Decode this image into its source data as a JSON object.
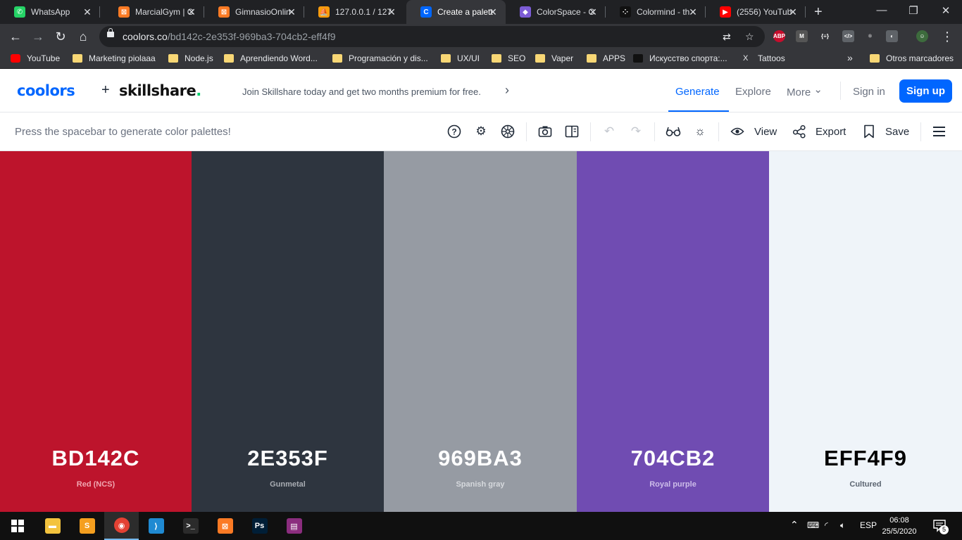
{
  "browser": {
    "tabs": [
      {
        "title": "WhatsApp",
        "icon": "whatsapp-icon",
        "icon_color": "#25d366",
        "glyph": "✆"
      },
      {
        "title": "MarcialGym | C",
        "icon": "xampp-icon",
        "icon_color": "#fb7a24",
        "glyph": "⊠"
      },
      {
        "title": "GimnasioOnlin",
        "icon": "xampp-icon",
        "icon_color": "#fb7a24",
        "glyph": "⊠"
      },
      {
        "title": "127.0.0.1 / 127",
        "icon": "phpmyadmin-icon",
        "icon_color": "#f89c0e",
        "glyph": "⛵"
      },
      {
        "title": "Create a palett",
        "icon": "coolors-icon",
        "icon_color": "#0066ff",
        "glyph": "C",
        "active": true
      },
      {
        "title": "ColorSpace - C",
        "icon": "colorspace-icon",
        "icon_color": "#7c5cd6",
        "glyph": "◆"
      },
      {
        "title": "Colormind - th",
        "icon": "colormind-icon",
        "icon_color": "#111111",
        "glyph": "⁘"
      },
      {
        "title": "(2556) YouTub",
        "icon": "youtube-icon",
        "icon_color": "#ff0000",
        "glyph": "▶"
      }
    ],
    "new_tab": "+",
    "address": {
      "host": "coolors.co",
      "path": "/bd142c-2e353f-969ba3-704cb2-eff4f9"
    },
    "extensions": [
      {
        "name": "adblock-icon",
        "label": "ABP",
        "color": "#c70d2c"
      },
      {
        "name": "mendeley-icon",
        "label": "M",
        "color": "#555555"
      },
      {
        "name": "json-viewer-icon",
        "label": "{≡}",
        "color": "#35363a"
      },
      {
        "name": "devtools-ext-icon",
        "label": "</>",
        "color": "#5f6368"
      },
      {
        "name": "react-devtools-icon",
        "label": "⚛",
        "color": "#35363a"
      },
      {
        "name": "colorpicker-ext-icon",
        "label": "◐",
        "color": "#5f6368"
      },
      {
        "name": "profile-avatar-icon",
        "label": "☺",
        "color": "#3d6b3d"
      }
    ],
    "bookmarks": [
      {
        "label": "YouTube",
        "icon": "youtube-icon",
        "kind": "yt"
      },
      {
        "label": "Marketing piolaaa",
        "icon": "folder-icon",
        "kind": "folder"
      },
      {
        "label": "Node.js",
        "icon": "folder-icon",
        "kind": "folder"
      },
      {
        "label": "Aprendiendo Word...",
        "icon": "folder-icon",
        "kind": "folder"
      },
      {
        "label": "Programación y dis...",
        "icon": "folder-icon",
        "kind": "folder"
      },
      {
        "label": "UX/UI",
        "icon": "folder-icon",
        "kind": "folder"
      },
      {
        "label": "SEO",
        "icon": "folder-icon",
        "kind": "folder"
      },
      {
        "label": "Vaper",
        "icon": "folder-icon",
        "kind": "folder"
      },
      {
        "label": "APPS",
        "icon": "folder-icon",
        "kind": "folder"
      },
      {
        "label": "Искусство спорта:...",
        "icon": "bookmark-site-icon",
        "kind": "dark"
      },
      {
        "label": "Tattoos",
        "icon": "x-site-icon",
        "kind": "x"
      }
    ],
    "bookmarks_overflow": "»",
    "other_bookmarks": "Otros marcadores"
  },
  "site": {
    "logo_left": "coolors",
    "logo_plus": "+",
    "logo_right": "skillshare",
    "logo_dot": ".",
    "promo": "Join Skillshare today and get two months premium for free.",
    "promo_chevron": "›",
    "nav": {
      "generate": "Generate",
      "explore": "Explore",
      "more": "More",
      "more_chevron": "⌄",
      "sign_in": "Sign in",
      "sign_up": "Sign up"
    }
  },
  "toolbar": {
    "hint": "Press the spacebar to generate color palettes!",
    "view_label": "View",
    "export_label": "Export",
    "save_label": "Save"
  },
  "palette": [
    {
      "hex": "BD142C",
      "name": "Red (NCS)",
      "bg": "#bd142c",
      "fg": "#ffffff",
      "sub": "#f0a7b1"
    },
    {
      "hex": "2E353F",
      "name": "Gunmetal",
      "bg": "#2e353f",
      "fg": "#ffffff",
      "sub": "#a9adb3"
    },
    {
      "hex": "969BA3",
      "name": "Spanish gray",
      "bg": "#969ba3",
      "fg": "#ffffff",
      "sub": "#d6d9dd"
    },
    {
      "hex": "704CB2",
      "name": "Royal purple",
      "bg": "#704cb2",
      "fg": "#ffffff",
      "sub": "#cdbde9"
    },
    {
      "hex": "EFF4F9",
      "name": "Cultured",
      "bg": "#eff4f9",
      "fg": "#000000",
      "sub": "#5b6470"
    }
  ],
  "taskbar": {
    "apps": [
      {
        "name": "file-explorer-icon",
        "glyph": "▬",
        "color": "#f3c33e",
        "running": false
      },
      {
        "name": "sublime-text-icon",
        "glyph": "S",
        "color": "#f59f1f",
        "running": false
      },
      {
        "name": "chrome-icon",
        "glyph": "◉",
        "color": "#e34133",
        "running": true
      },
      {
        "name": "vscode-icon",
        "glyph": "⟩",
        "color": "#1f8ad2",
        "running": false
      },
      {
        "name": "terminal-icon",
        "glyph": ">_",
        "color": "#2b2b2b",
        "running": false
      },
      {
        "name": "xampp-icon",
        "glyph": "⊠",
        "color": "#fb7a24",
        "running": false
      },
      {
        "name": "photoshop-icon",
        "glyph": "Ps",
        "color": "#001e36",
        "running": false
      },
      {
        "name": "winrar-icon",
        "glyph": "▤",
        "color": "#8b2d7e",
        "running": false
      }
    ],
    "language": "ESP",
    "time": "06:08",
    "date": "25/5/2020",
    "notifications": "5"
  }
}
